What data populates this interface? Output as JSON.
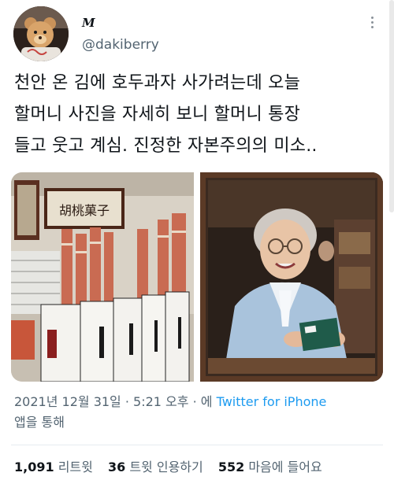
{
  "author": {
    "display_name": "M",
    "handle": "@dakiberry",
    "avatar_icon": "teddy-bear-avatar"
  },
  "tweet": {
    "lines": [
      "천안 온 김에 호두과자 사가려는데 오늘",
      "할머니 사진을 자세히 보니 할머니 통장",
      "들고 웃고 계심. 진정한 자본주의의 미소.."
    ]
  },
  "media": {
    "left_sign": "胡桃菓子",
    "count": 2
  },
  "meta": {
    "timestamp": "2021년 12월 31일 · 5:21 오후 · 에",
    "source": "Twitter for iPhone",
    "suffix": "앱을 통해"
  },
  "stats": {
    "retweets_count": "1,091",
    "retweets_label": "리트윗",
    "quotes_count": "36",
    "quotes_label": "트윗 인용하기",
    "likes_count": "552",
    "likes_label": "마음에 들어요"
  },
  "colors": {
    "link": "#1d9bf0",
    "secondary_text": "#536471",
    "primary_text": "#0f1419"
  }
}
